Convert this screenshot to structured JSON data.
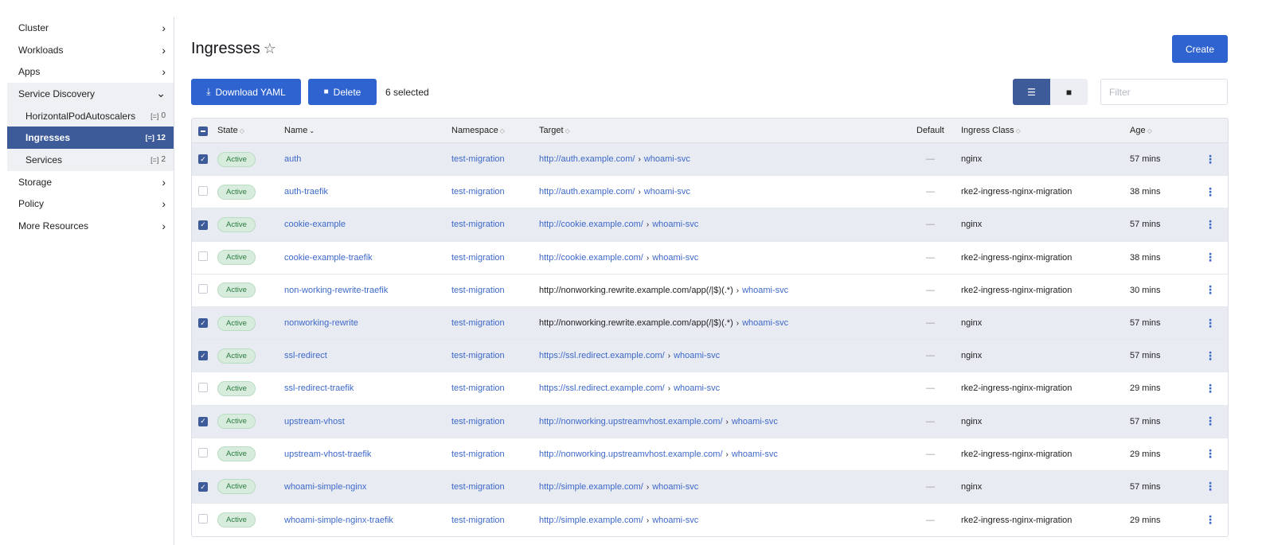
{
  "sidebar": {
    "items": [
      {
        "label": "Cluster",
        "chev": "›"
      },
      {
        "label": "Workloads",
        "chev": "›"
      },
      {
        "label": "Apps",
        "chev": "›"
      },
      {
        "label": "Service Discovery",
        "chev": "⌄"
      }
    ],
    "sub_items": [
      {
        "label": "HorizontalPodAutoscalers",
        "count": "0"
      },
      {
        "label": "Ingresses",
        "count": "12"
      },
      {
        "label": "Services",
        "count": "2"
      }
    ],
    "items_after": [
      {
        "label": "Storage",
        "chev": "›"
      },
      {
        "label": "Policy",
        "chev": "›"
      },
      {
        "label": "More Resources",
        "chev": "›"
      }
    ]
  },
  "header": {
    "title": "Ingresses",
    "create_label": "Create"
  },
  "toolbar": {
    "download_label": "Download YAML",
    "delete_label": "Delete",
    "selected_text": "6 selected",
    "filter_placeholder": "Filter"
  },
  "table": {
    "columns": {
      "state": "State",
      "name": "Name",
      "namespace": "Namespace",
      "target": "Target",
      "default": "Default",
      "ingress_class": "Ingress Class",
      "age": "Age"
    },
    "rows": [
      {
        "checked": true,
        "state": "Active",
        "name": "auth",
        "namespace": "test-migration",
        "target_url": "http://auth.example.com/",
        "target_svc": "whoami-svc",
        "target_url_plain": false,
        "default": "—",
        "ingress_class": "nginx",
        "age": "57 mins"
      },
      {
        "checked": false,
        "state": "Active",
        "name": "auth-traefik",
        "namespace": "test-migration",
        "target_url": "http://auth.example.com/",
        "target_svc": "whoami-svc",
        "target_url_plain": false,
        "default": "—",
        "ingress_class": "rke2-ingress-nginx-migration",
        "age": "38 mins"
      },
      {
        "checked": true,
        "state": "Active",
        "name": "cookie-example",
        "namespace": "test-migration",
        "target_url": "http://cookie.example.com/",
        "target_svc": "whoami-svc",
        "target_url_plain": false,
        "default": "—",
        "ingress_class": "nginx",
        "age": "57 mins"
      },
      {
        "checked": false,
        "state": "Active",
        "name": "cookie-example-traefik",
        "namespace": "test-migration",
        "target_url": "http://cookie.example.com/",
        "target_svc": "whoami-svc",
        "target_url_plain": false,
        "default": "—",
        "ingress_class": "rke2-ingress-nginx-migration",
        "age": "38 mins"
      },
      {
        "checked": false,
        "state": "Active",
        "name": "non-working-rewrite-traefik",
        "namespace": "test-migration",
        "target_url": "http://nonworking.rewrite.example.com/app(/|$)(.*)",
        "target_svc": "whoami-svc",
        "target_url_plain": true,
        "default": "—",
        "ingress_class": "rke2-ingress-nginx-migration",
        "age": "30 mins"
      },
      {
        "checked": true,
        "state": "Active",
        "name": "nonworking-rewrite",
        "namespace": "test-migration",
        "target_url": "http://nonworking.rewrite.example.com/app(/|$)(.*)",
        "target_svc": "whoami-svc",
        "target_url_plain": true,
        "default": "—",
        "ingress_class": "nginx",
        "age": "57 mins"
      },
      {
        "checked": true,
        "state": "Active",
        "name": "ssl-redirect",
        "namespace": "test-migration",
        "target_url": "https://ssl.redirect.example.com/",
        "target_svc": "whoami-svc",
        "target_url_plain": false,
        "default": "—",
        "ingress_class": "nginx",
        "age": "57 mins"
      },
      {
        "checked": false,
        "state": "Active",
        "name": "ssl-redirect-traefik",
        "namespace": "test-migration",
        "target_url": "https://ssl.redirect.example.com/",
        "target_svc": "whoami-svc",
        "target_url_plain": false,
        "default": "—",
        "ingress_class": "rke2-ingress-nginx-migration",
        "age": "29 mins"
      },
      {
        "checked": true,
        "state": "Active",
        "name": "upstream-vhost",
        "namespace": "test-migration",
        "target_url": "http://nonworking.upstreamvhost.example.com/",
        "target_svc": "whoami-svc",
        "target_url_plain": false,
        "default": "—",
        "ingress_class": "nginx",
        "age": "57 mins"
      },
      {
        "checked": false,
        "state": "Active",
        "name": "upstream-vhost-traefik",
        "namespace": "test-migration",
        "target_url": "http://nonworking.upstreamvhost.example.com/",
        "target_svc": "whoami-svc",
        "target_url_plain": false,
        "default": "—",
        "ingress_class": "rke2-ingress-nginx-migration",
        "age": "29 mins"
      },
      {
        "checked": true,
        "state": "Active",
        "name": "whoami-simple-nginx",
        "namespace": "test-migration",
        "target_url": "http://simple.example.com/",
        "target_svc": "whoami-svc",
        "target_url_plain": false,
        "default": "—",
        "ingress_class": "nginx",
        "age": "57 mins"
      },
      {
        "checked": false,
        "state": "Active",
        "name": "whoami-simple-nginx-traefik",
        "namespace": "test-migration",
        "target_url": "http://simple.example.com/",
        "target_svc": "whoami-svc",
        "target_url_plain": false,
        "default": "—",
        "ingress_class": "rke2-ingress-nginx-migration",
        "age": "29 mins"
      }
    ]
  },
  "colors": {
    "primary": "#2f63cf",
    "active_nav": "#3d5a99",
    "link": "#3d68c8",
    "badge_bg": "#d8ecdd",
    "badge_text": "#2a7a3e"
  }
}
